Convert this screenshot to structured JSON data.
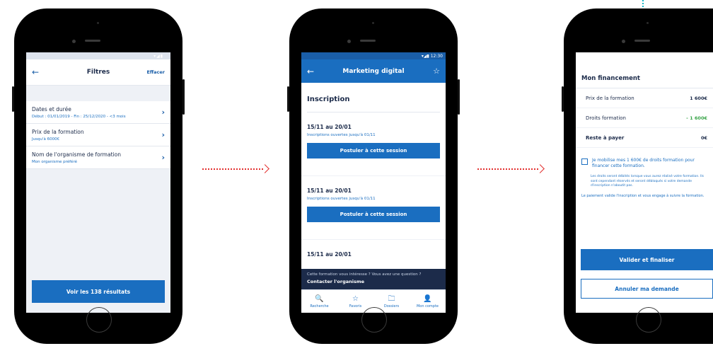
{
  "colors": {
    "primary": "#1a6ec0",
    "dark": "#1c2b4a",
    "accent_arrow": "#e3302f",
    "green": "#3aa54a",
    "background": "#eef1f6"
  },
  "screen1": {
    "status_icons": "▾◢▮",
    "header": {
      "back_icon": "arrow-left-icon",
      "back_glyph": "←",
      "title": "Filtres",
      "clear": "Effacer"
    },
    "rows": [
      {
        "title": "Dates et durée",
        "value": "Début : 01/01/2019  -  Fin : 25/12/2020  -  <3 mois"
      },
      {
        "title": "Prix de la formation",
        "value": "Jusqu'à 6000€"
      },
      {
        "title": "Nom de l'organisme de formation",
        "value": "Mon organisme préféré"
      }
    ],
    "chevron_glyph": "›",
    "results_button": "Voir les 138 résultats"
  },
  "screen2": {
    "status_text": "▾◢▮ 12:30",
    "header": {
      "back_glyph": "←",
      "title": "Marketing digital",
      "star_glyph": "☆"
    },
    "section_title": "Inscription",
    "sessions": [
      {
        "dates": "15/11 au 20/01",
        "note": "Inscriptions ouvertes jusqu'à 01/11",
        "button": "Postuler à cette session"
      },
      {
        "dates": "15/11 au 20/01",
        "note": "Inscriptions ouvertes jusqu'à 01/11",
        "button": "Postuler à cette session"
      },
      {
        "dates": "15/11 au 20/01"
      }
    ],
    "banner": {
      "question": "Cette formation vous intéresse ? Vous avez une question ?",
      "contact": "Contacter l'organisme"
    },
    "tabs": [
      {
        "icon": "search-icon",
        "glyph": "🔍",
        "label": "Recherche"
      },
      {
        "icon": "star-icon",
        "glyph": "☆",
        "label": "Favoris"
      },
      {
        "icon": "folder-icon",
        "glyph": "🗀",
        "label": "Dossiers"
      },
      {
        "icon": "user-icon",
        "glyph": "👤",
        "label": "Mon compte"
      }
    ]
  },
  "screen3": {
    "title": "Mon financement",
    "lines": [
      {
        "label": "Prix de la formation",
        "amount": "1 600€"
      },
      {
        "label": "Droits formation",
        "amount": "- 1 600€"
      },
      {
        "label": "Reste à payer",
        "amount": "0€"
      }
    ],
    "checkbox_text": "Je mobilise mes 1 600€ de droits formation pour financer cette formation.",
    "note": "Les droits seront débités lorsque vous aurez réalisé votre formation. Ils sont cependant réservés et seront débloqués si votre demande d'inscription n'aboutit pas.",
    "payment_note": "Le paiement valide l'inscription et vous engage à suivre la formation.",
    "validate_button": "Valider et finaliser",
    "cancel_button": "Annuler ma demande"
  }
}
